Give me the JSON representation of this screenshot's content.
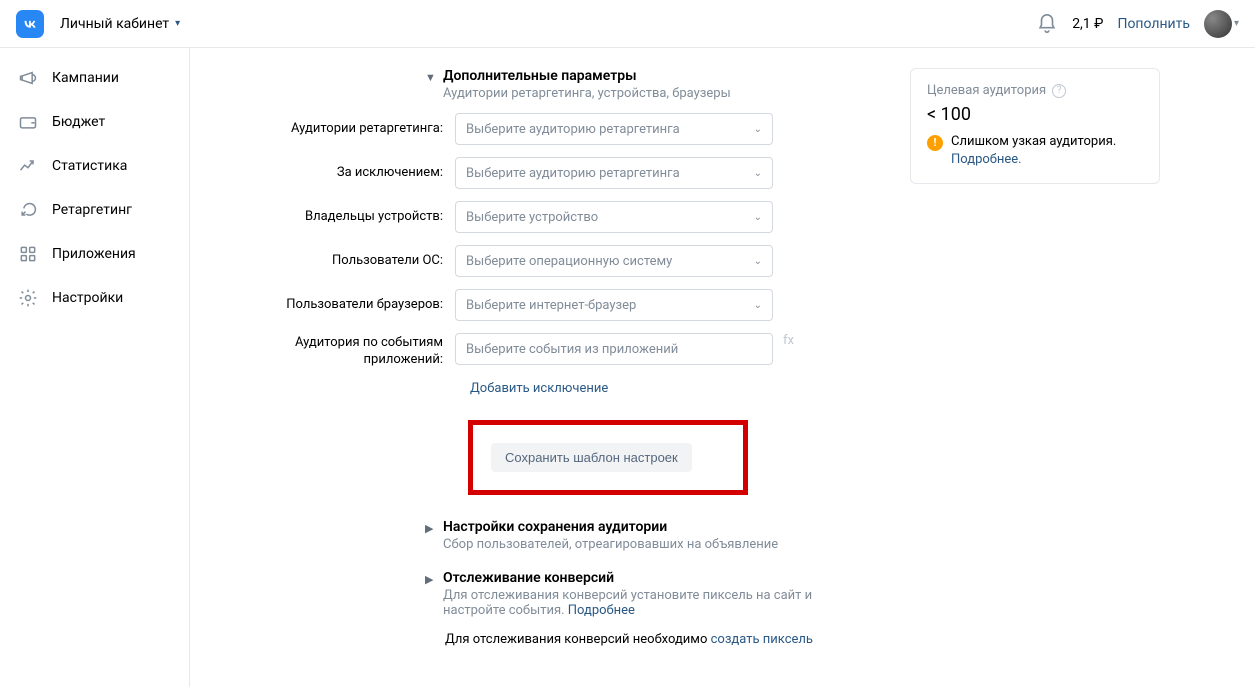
{
  "header": {
    "account_title": "Личный кабинет",
    "balance": "2,1 ₽",
    "topup": "Пополнить"
  },
  "sidebar": {
    "items": [
      {
        "label": "Кампании"
      },
      {
        "label": "Бюджет"
      },
      {
        "label": "Статистика"
      },
      {
        "label": "Ретаргетинг"
      },
      {
        "label": "Приложения"
      },
      {
        "label": "Настройки"
      }
    ]
  },
  "form": {
    "section_title": "Дополнительные параметры",
    "section_sub": "Аудитории ретаргетинга, устройства, браузеры",
    "rows": {
      "retarget_audiences": {
        "label": "Аудитории ретаргетинга:",
        "placeholder": "Выберите аудиторию ретаргетинга"
      },
      "except": {
        "label": "За исключением:",
        "placeholder": "Выберите аудиторию ретаргетинга"
      },
      "device_owners": {
        "label": "Владельцы устройств:",
        "placeholder": "Выберите устройство"
      },
      "os_users": {
        "label": "Пользователи ОС:",
        "placeholder": "Выберите операционную систему"
      },
      "browser_users": {
        "label": "Пользователи браузеров:",
        "placeholder": "Выберите интернет-браузер"
      },
      "app_events": {
        "label": "Аудитория по событиям приложений:",
        "placeholder": "Выберите события из приложений",
        "fx": "fx"
      }
    },
    "add_exception_link": "Добавить исключение",
    "save_template_btn": "Сохранить шаблон настроек",
    "audience_save_section": {
      "title": "Настройки сохранения аудитории",
      "sub": "Сбор пользователей, отреагировавших на объявление"
    },
    "conversions_section": {
      "title": "Отслеживание конверсий",
      "sub_prefix": "Для отслеживания конверсий установите пиксель на сайт и настройте события.",
      "sub_link": "Подробнее",
      "note_prefix": "Для отслеживания конверсий необходимо",
      "note_link": "создать пиксель"
    }
  },
  "audience_card": {
    "label": "Целевая аудитория",
    "value": "< 100",
    "warn_text": "Слишком узкая аудитория.",
    "warn_link": "Подробнее."
  }
}
